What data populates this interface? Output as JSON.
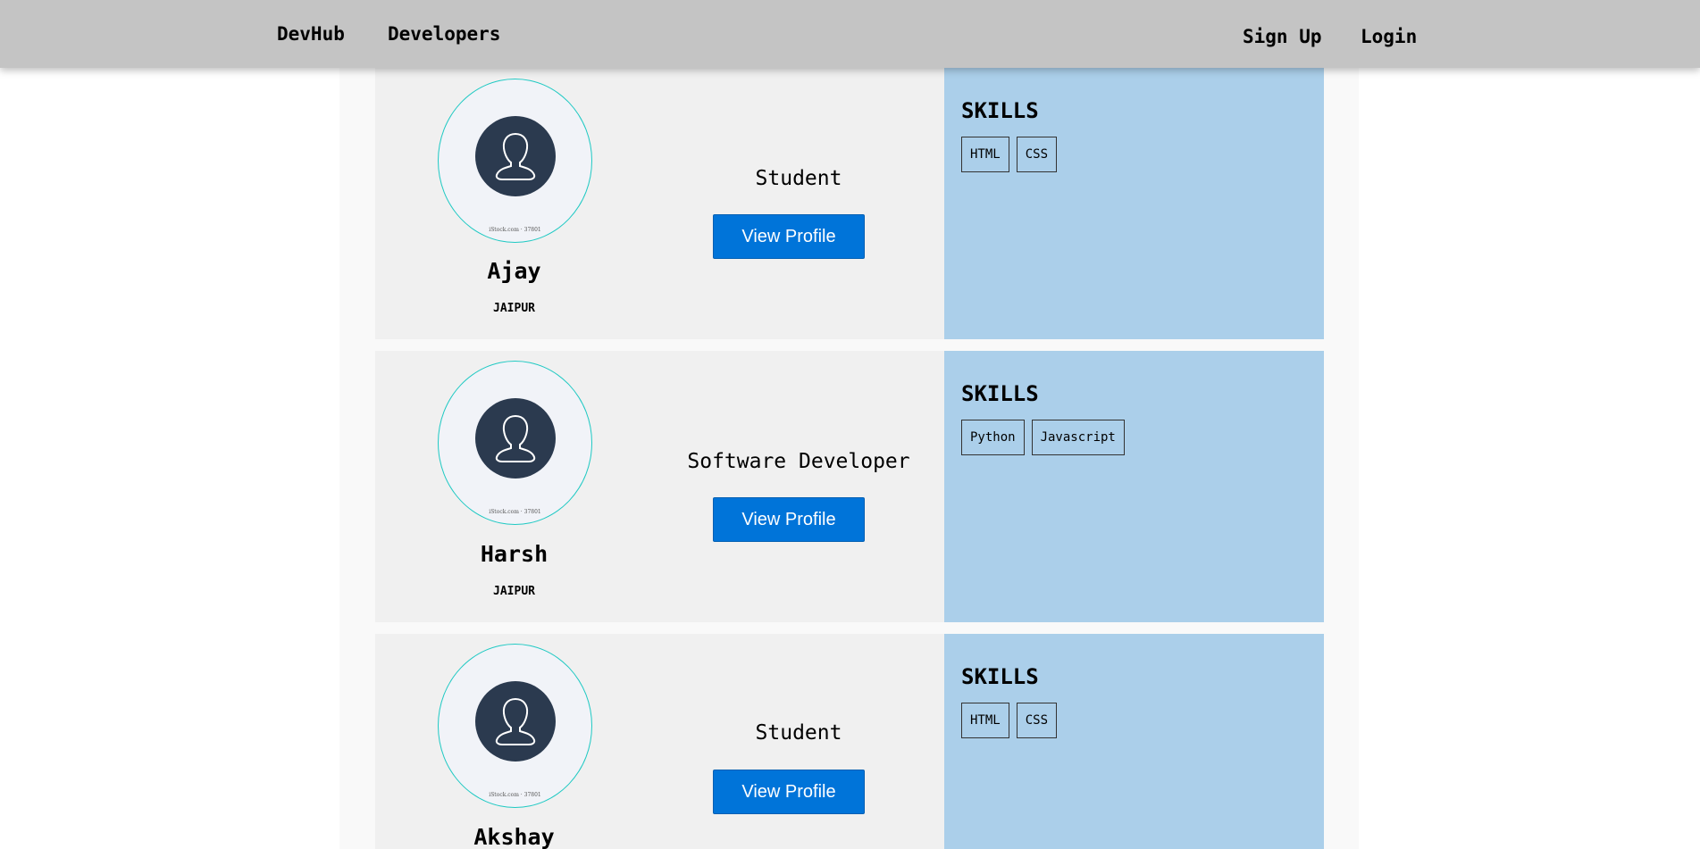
{
  "nav": {
    "brand": "DevHub",
    "developers": "Developers",
    "signup": "Sign Up",
    "login": "Login"
  },
  "avatar_watermark": "iStock.com · 37801",
  "developers": [
    {
      "name": "Ajay",
      "city": "JAIPUR",
      "title": "Student",
      "button": "View Profile",
      "skills_heading": "SKILLS",
      "skills": [
        "HTML",
        "CSS"
      ]
    },
    {
      "name": "Harsh",
      "city": "JAIPUR",
      "title": "Software Developer",
      "button": "View Profile",
      "skills_heading": "SKILLS",
      "skills": [
        "Python",
        "Javascript"
      ]
    },
    {
      "name": "Akshay",
      "city": "",
      "title": "Student",
      "button": "View Profile",
      "skills_heading": "SKILLS",
      "skills": [
        "HTML",
        "CSS"
      ]
    }
  ],
  "colors": {
    "navbar": "#c4c4c4",
    "card": "#f0f0f0",
    "skills_panel": "#abcfea",
    "button": "#0074d9",
    "avatar_ring": "#1fc9c3",
    "avatar_icon": "#2b3a4f"
  }
}
